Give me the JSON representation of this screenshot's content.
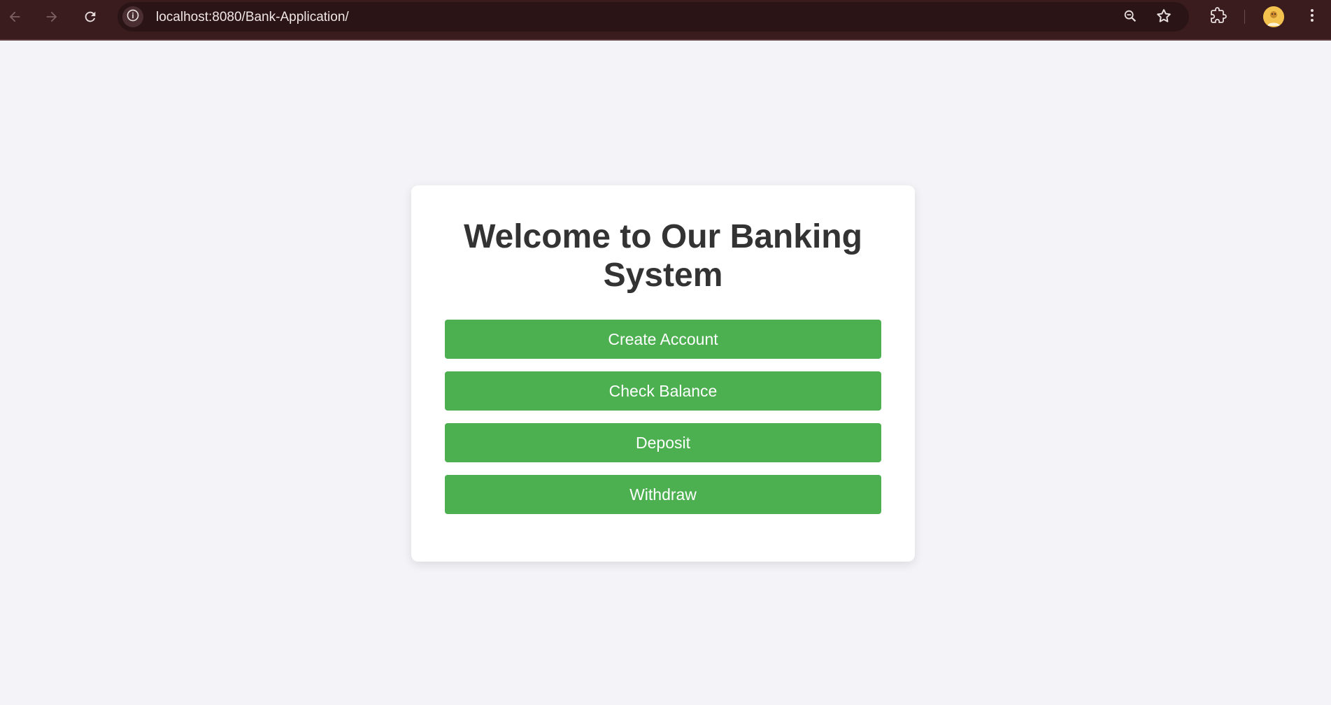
{
  "browser": {
    "url": "localhost:8080/Bank-Application/",
    "icons": {
      "back": "arrow-left-icon",
      "forward": "arrow-right-icon",
      "reload": "reload-icon",
      "site_info": "info-icon",
      "zoom": "zoom-icon",
      "bookmark": "star-icon",
      "extensions": "puzzle-icon",
      "menu": "kebab-menu-icon"
    },
    "colors": {
      "toolbar_bg": "#3a1c1f",
      "omnibox_bg": "#2a1416"
    }
  },
  "page": {
    "title": "Welcome to Our Banking System",
    "buttons": [
      {
        "label": "Create Account"
      },
      {
        "label": "Check Balance"
      },
      {
        "label": "Deposit"
      },
      {
        "label": "Withdraw"
      }
    ],
    "colors": {
      "background": "#f4f4f8",
      "card": "#ffffff",
      "button": "#4caf50",
      "heading": "#333333"
    }
  }
}
